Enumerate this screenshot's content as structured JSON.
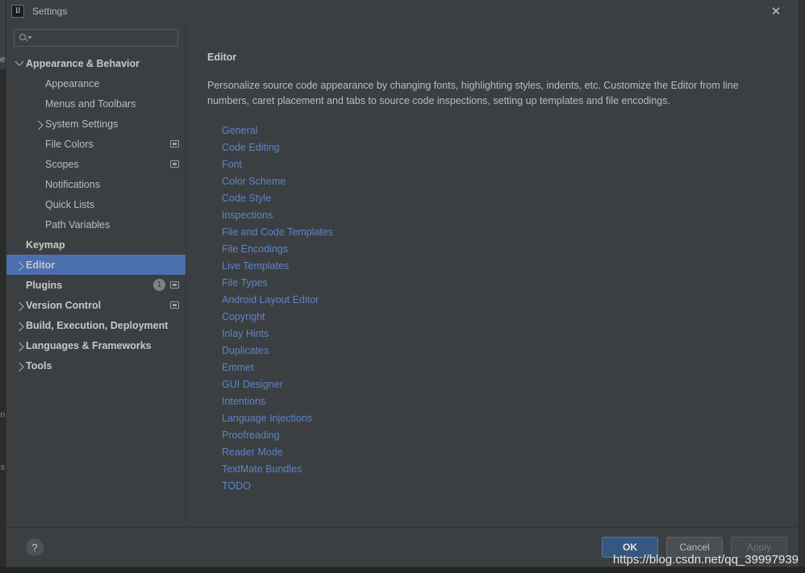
{
  "window": {
    "title": "Settings",
    "app_icon": "intellij-idea-icon",
    "close_icon": "close-icon"
  },
  "search": {
    "placeholder": "",
    "value": "",
    "icon": "search-icon"
  },
  "sidebar": {
    "items": [
      {
        "label": "Appearance & Behavior",
        "level": 0,
        "arrow": "down",
        "bold": true,
        "selected": false,
        "badge": null,
        "copy_icon": false
      },
      {
        "label": "Appearance",
        "level": 1,
        "arrow": "none",
        "bold": false,
        "selected": false,
        "badge": null,
        "copy_icon": false
      },
      {
        "label": "Menus and Toolbars",
        "level": 1,
        "arrow": "none",
        "bold": false,
        "selected": false,
        "badge": null,
        "copy_icon": false
      },
      {
        "label": "System Settings",
        "level": 1,
        "arrow": "right",
        "bold": false,
        "selected": false,
        "badge": null,
        "copy_icon": false
      },
      {
        "label": "File Colors",
        "level": 1,
        "arrow": "none",
        "bold": false,
        "selected": false,
        "badge": null,
        "copy_icon": true
      },
      {
        "label": "Scopes",
        "level": 1,
        "arrow": "none",
        "bold": false,
        "selected": false,
        "badge": null,
        "copy_icon": true
      },
      {
        "label": "Notifications",
        "level": 1,
        "arrow": "none",
        "bold": false,
        "selected": false,
        "badge": null,
        "copy_icon": false
      },
      {
        "label": "Quick Lists",
        "level": 1,
        "arrow": "none",
        "bold": false,
        "selected": false,
        "badge": null,
        "copy_icon": false
      },
      {
        "label": "Path Variables",
        "level": 1,
        "arrow": "none",
        "bold": false,
        "selected": false,
        "badge": null,
        "copy_icon": false
      },
      {
        "label": "Keymap",
        "level": 0,
        "arrow": "none",
        "bold": true,
        "selected": false,
        "badge": null,
        "copy_icon": false
      },
      {
        "label": "Editor",
        "level": 0,
        "arrow": "right",
        "bold": true,
        "selected": true,
        "badge": null,
        "copy_icon": false
      },
      {
        "label": "Plugins",
        "level": 0,
        "arrow": "none",
        "bold": true,
        "selected": false,
        "badge": "1",
        "copy_icon": true
      },
      {
        "label": "Version Control",
        "level": 0,
        "arrow": "right",
        "bold": true,
        "selected": false,
        "badge": null,
        "copy_icon": true
      },
      {
        "label": "Build, Execution, Deployment",
        "level": 0,
        "arrow": "right",
        "bold": true,
        "selected": false,
        "badge": null,
        "copy_icon": false
      },
      {
        "label": "Languages & Frameworks",
        "level": 0,
        "arrow": "right",
        "bold": true,
        "selected": false,
        "badge": null,
        "copy_icon": false
      },
      {
        "label": "Tools",
        "level": 0,
        "arrow": "right",
        "bold": true,
        "selected": false,
        "badge": null,
        "copy_icon": false
      }
    ]
  },
  "content": {
    "title": "Editor",
    "description": "Personalize source code appearance by changing fonts, highlighting styles, indents, etc. Customize the Editor from line numbers, caret placement and tabs to source code inspections, setting up templates and file encodings.",
    "links": [
      "General",
      "Code Editing",
      "Font",
      "Color Scheme",
      "Code Style",
      "Inspections",
      "File and Code Templates",
      "File Encodings",
      "Live Templates",
      "File Types",
      "Android Layout Editor",
      "Copyright",
      "Inlay Hints",
      "Duplicates",
      "Emmet",
      "GUI Designer",
      "Intentions",
      "Language Injections",
      "Proofreading",
      "Reader Mode",
      "TextMate Bundles",
      "TODO"
    ],
    "link_color": "#5c84c8"
  },
  "footer": {
    "help_label": "?",
    "help_icon": "help-icon",
    "ok_label": "OK",
    "cancel_label": "Cancel",
    "apply_label": "Apply",
    "apply_disabled": true,
    "ok_color": "#365880"
  },
  "backdrop": {
    "tab_fragment": "es",
    "code_fragment_1": "n\\",
    "code_fragment_2": "sh"
  },
  "watermark": {
    "text": "https://blog.csdn.net/qq_39997939"
  },
  "colors": {
    "dialog_bg": "#3c3f41",
    "selection": "#4b6eaf",
    "text": "#bbbbbb",
    "link": "#5c84c8",
    "ide_bg": "#2b2b2b"
  }
}
